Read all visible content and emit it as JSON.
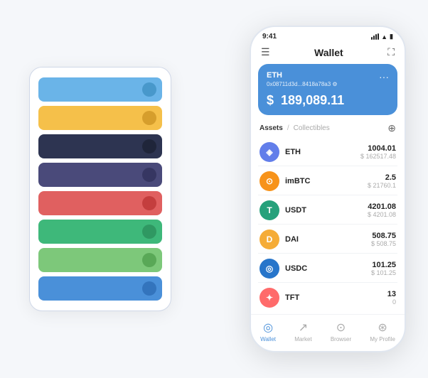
{
  "phone": {
    "status_bar": {
      "time": "9:41",
      "signal": "●●●",
      "wifi": "WiFi",
      "battery": "Battery"
    },
    "header": {
      "menu_icon": "☰",
      "title": "Wallet",
      "expand_icon": "⛶"
    },
    "eth_card": {
      "title": "ETH",
      "address": "0x08711d3d...8418a78a3  ⚙",
      "currency": "$",
      "balance": "189,089.11",
      "dots": "···"
    },
    "assets_section": {
      "tab_active": "Assets",
      "divider": "/",
      "tab_inactive": "Collectibles",
      "add_icon": "⊕"
    },
    "assets": [
      {
        "id": "eth",
        "icon": "◈",
        "name": "ETH",
        "amount": "1004.01",
        "usd": "$ 162517.48",
        "icon_class": "icon-eth"
      },
      {
        "id": "imbtc",
        "icon": "⊙",
        "name": "imBTC",
        "amount": "2.5",
        "usd": "$ 21760.1",
        "icon_class": "icon-imbtc"
      },
      {
        "id": "usdt",
        "icon": "T",
        "name": "USDT",
        "amount": "4201.08",
        "usd": "$ 4201.08",
        "icon_class": "icon-usdt"
      },
      {
        "id": "dai",
        "icon": "D",
        "name": "DAI",
        "amount": "508.75",
        "usd": "$ 508.75",
        "icon_class": "icon-dai"
      },
      {
        "id": "usdc",
        "icon": "◎",
        "name": "USDC",
        "amount": "101.25",
        "usd": "$ 101.25",
        "icon_class": "icon-usdc"
      },
      {
        "id": "tft",
        "icon": "✦",
        "name": "TFT",
        "amount": "13",
        "usd": "0",
        "icon_class": "icon-tft"
      }
    ],
    "nav": [
      {
        "id": "wallet",
        "icon": "◎",
        "label": "Wallet",
        "active": true
      },
      {
        "id": "market",
        "icon": "↗",
        "label": "Market",
        "active": false
      },
      {
        "id": "browser",
        "icon": "⊙",
        "label": "Browser",
        "active": false
      },
      {
        "id": "profile",
        "icon": "⊛",
        "label": "My Profile",
        "active": false
      }
    ]
  },
  "card_stack": {
    "cards": [
      {
        "id": "card1",
        "color": "#6ab4e8",
        "dot_color": "#3a8bbf"
      },
      {
        "id": "card2",
        "color": "#f5c04a",
        "dot_color": "#c99020"
      },
      {
        "id": "card3",
        "color": "#2d3451",
        "dot_color": "#1a2030"
      },
      {
        "id": "card4",
        "color": "#4a4a7a",
        "dot_color": "#2e2e58"
      },
      {
        "id": "card5",
        "color": "#e06060",
        "dot_color": "#b83030"
      },
      {
        "id": "card6",
        "color": "#3eb87a",
        "dot_color": "#2a8a58"
      },
      {
        "id": "card7",
        "color": "#7dc87a",
        "dot_color": "#4a9a48"
      },
      {
        "id": "card8",
        "color": "#4a90d9",
        "dot_color": "#2a68b0"
      }
    ]
  }
}
